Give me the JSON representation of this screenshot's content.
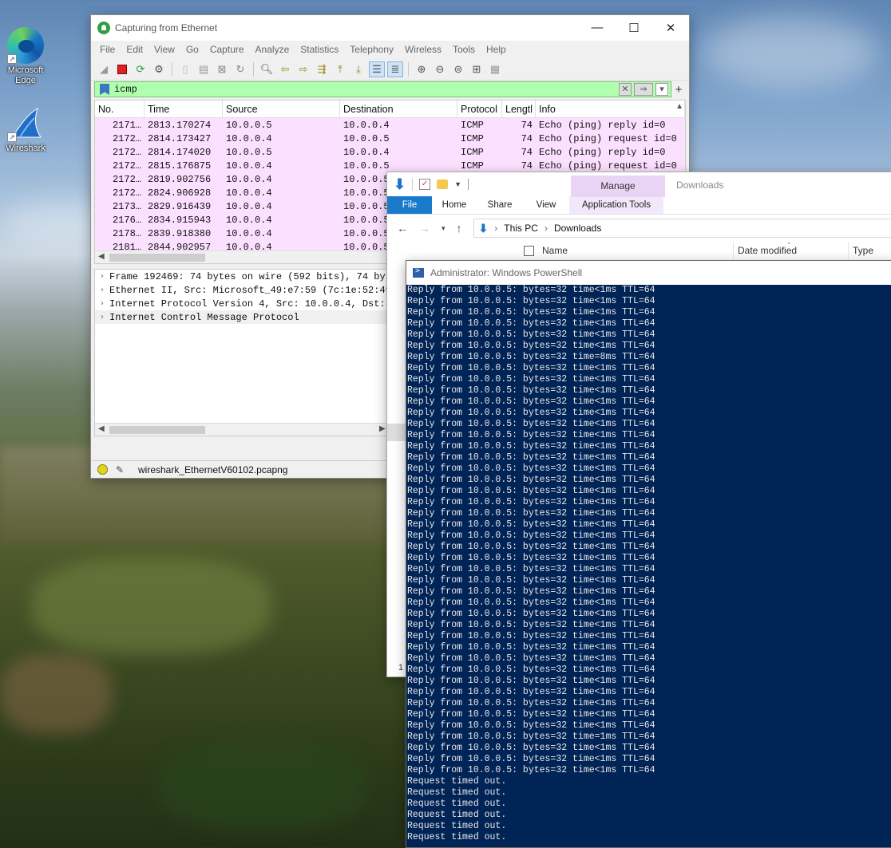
{
  "desktop": {
    "icons": [
      {
        "label": "Microsoft Edge"
      },
      {
        "label": "Wireshark"
      }
    ]
  },
  "wireshark": {
    "title": "Capturing from Ethernet",
    "menu": [
      "File",
      "Edit",
      "View",
      "Go",
      "Capture",
      "Analyze",
      "Statistics",
      "Telephony",
      "Wireless",
      "Tools",
      "Help"
    ],
    "filter": "icmp",
    "columns": [
      "No.",
      "Time",
      "Source",
      "Destination",
      "Protocol",
      "Lengtl",
      "Info"
    ],
    "packets": [
      {
        "no": "2171…",
        "time": "2813.170274",
        "src": "10.0.0.5",
        "dst": "10.0.0.4",
        "proto": "ICMP",
        "len": "74",
        "info": "Echo (ping) reply    id=0"
      },
      {
        "no": "2172…",
        "time": "2814.173427",
        "src": "10.0.0.4",
        "dst": "10.0.0.5",
        "proto": "ICMP",
        "len": "74",
        "info": "Echo (ping) request  id=0"
      },
      {
        "no": "2172…",
        "time": "2814.174020",
        "src": "10.0.0.5",
        "dst": "10.0.0.4",
        "proto": "ICMP",
        "len": "74",
        "info": "Echo (ping) reply    id=0"
      },
      {
        "no": "2172…",
        "time": "2815.176875",
        "src": "10.0.0.4",
        "dst": "10.0.0.5",
        "proto": "ICMP",
        "len": "74",
        "info": "Echo (ping) request  id=0"
      },
      {
        "no": "2172…",
        "time": "2819.902756",
        "src": "10.0.0.4",
        "dst": "10.0.0.5",
        "proto": "",
        "len": "",
        "info": ""
      },
      {
        "no": "2172…",
        "time": "2824.906928",
        "src": "10.0.0.4",
        "dst": "10.0.0.5",
        "proto": "",
        "len": "",
        "info": ""
      },
      {
        "no": "2173…",
        "time": "2829.916439",
        "src": "10.0.0.4",
        "dst": "10.0.0.5",
        "proto": "",
        "len": "",
        "info": ""
      },
      {
        "no": "2176…",
        "time": "2834.915943",
        "src": "10.0.0.4",
        "dst": "10.0.0.5",
        "proto": "",
        "len": "",
        "info": ""
      },
      {
        "no": "2178…",
        "time": "2839.918380",
        "src": "10.0.0.4",
        "dst": "10.0.0.5",
        "proto": "",
        "len": "",
        "info": ""
      },
      {
        "no": "2181…",
        "time": "2844.902957",
        "src": "10.0.0.4",
        "dst": "10.0.0.5",
        "proto": "",
        "len": "",
        "info": ""
      }
    ],
    "details": [
      "Frame 192469: 74 bytes on wire (592 bits), 74 byte",
      "Ethernet II, Src: Microsoft_49:e7:59 (7c:1e:52:49:",
      "Internet Protocol Version 4, Src: 10.0.0.4, Dst: 1",
      "Internet Control Message Protocol"
    ],
    "status_file": "wireshark_EthernetV60102.pcapng"
  },
  "explorer": {
    "title": "Downloads",
    "manage_label": "Manage",
    "tabs": {
      "file": "File",
      "home": "Home",
      "share": "Share",
      "view": "View",
      "app_tools": "Application Tools"
    },
    "breadcrumb": [
      "This PC",
      "Downloads"
    ],
    "columns": {
      "name": "Name",
      "date": "Date modified",
      "type": "Type"
    },
    "left_number": "1"
  },
  "powershell": {
    "title": "Administrator: Windows PowerShell",
    "lines": [
      "Reply from 10.0.0.5: bytes=32 time<1ms TTL=64",
      "Reply from 10.0.0.5: bytes=32 time<1ms TTL=64",
      "Reply from 10.0.0.5: bytes=32 time<1ms TTL=64",
      "Reply from 10.0.0.5: bytes=32 time<1ms TTL=64",
      "Reply from 10.0.0.5: bytes=32 time<1ms TTL=64",
      "Reply from 10.0.0.5: bytes=32 time<1ms TTL=64",
      "Reply from 10.0.0.5: bytes=32 time=8ms TTL=64",
      "Reply from 10.0.0.5: bytes=32 time<1ms TTL=64",
      "Reply from 10.0.0.5: bytes=32 time<1ms TTL=64",
      "Reply from 10.0.0.5: bytes=32 time<1ms TTL=64",
      "Reply from 10.0.0.5: bytes=32 time<1ms TTL=64",
      "Reply from 10.0.0.5: bytes=32 time<1ms TTL=64",
      "Reply from 10.0.0.5: bytes=32 time<1ms TTL=64",
      "Reply from 10.0.0.5: bytes=32 time<1ms TTL=64",
      "Reply from 10.0.0.5: bytes=32 time<1ms TTL=64",
      "Reply from 10.0.0.5: bytes=32 time<1ms TTL=64",
      "Reply from 10.0.0.5: bytes=32 time<1ms TTL=64",
      "Reply from 10.0.0.5: bytes=32 time<1ms TTL=64",
      "Reply from 10.0.0.5: bytes=32 time<1ms TTL=64",
      "Reply from 10.0.0.5: bytes=32 time<1ms TTL=64",
      "Reply from 10.0.0.5: bytes=32 time<1ms TTL=64",
      "Reply from 10.0.0.5: bytes=32 time<1ms TTL=64",
      "Reply from 10.0.0.5: bytes=32 time<1ms TTL=64",
      "Reply from 10.0.0.5: bytes=32 time<1ms TTL=64",
      "Reply from 10.0.0.5: bytes=32 time<1ms TTL=64",
      "Reply from 10.0.0.5: bytes=32 time<1ms TTL=64",
      "Reply from 10.0.0.5: bytes=32 time<1ms TTL=64",
      "Reply from 10.0.0.5: bytes=32 time<1ms TTL=64",
      "Reply from 10.0.0.5: bytes=32 time<1ms TTL=64",
      "Reply from 10.0.0.5: bytes=32 time<1ms TTL=64",
      "Reply from 10.0.0.5: bytes=32 time<1ms TTL=64",
      "Reply from 10.0.0.5: bytes=32 time<1ms TTL=64",
      "Reply from 10.0.0.5: bytes=32 time<1ms TTL=64",
      "Reply from 10.0.0.5: bytes=32 time<1ms TTL=64",
      "Reply from 10.0.0.5: bytes=32 time<1ms TTL=64",
      "Reply from 10.0.0.5: bytes=32 time<1ms TTL=64",
      "Reply from 10.0.0.5: bytes=32 time<1ms TTL=64",
      "Reply from 10.0.0.5: bytes=32 time<1ms TTL=64",
      "Reply from 10.0.0.5: bytes=32 time<1ms TTL=64",
      "Reply from 10.0.0.5: bytes=32 time<1ms TTL=64",
      "Reply from 10.0.0.5: bytes=32 time=1ms TTL=64",
      "Reply from 10.0.0.5: bytes=32 time<1ms TTL=64",
      "Reply from 10.0.0.5: bytes=32 time<1ms TTL=64",
      "Reply from 10.0.0.5: bytes=32 time<1ms TTL=64",
      "Request timed out.",
      "Request timed out.",
      "Request timed out.",
      "Request timed out.",
      "Request timed out.",
      "Request timed out."
    ]
  }
}
